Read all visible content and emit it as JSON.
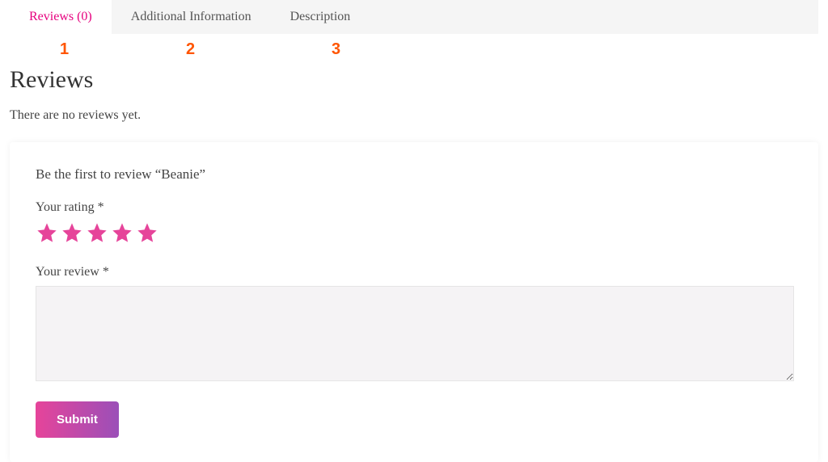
{
  "tabs": [
    {
      "label": "Reviews (0)",
      "active": true
    },
    {
      "label": "Additional Information",
      "active": false
    },
    {
      "label": "Description",
      "active": false
    }
  ],
  "annotations": [
    "1",
    "2",
    "3"
  ],
  "reviews": {
    "title": "Reviews",
    "empty_message": "There are no reviews yet."
  },
  "form": {
    "prompt": "Be the first to review “Beanie”",
    "rating_label": "Your rating *",
    "star_count": 5,
    "review_label": "Your review *",
    "submit_label": "Submit"
  }
}
